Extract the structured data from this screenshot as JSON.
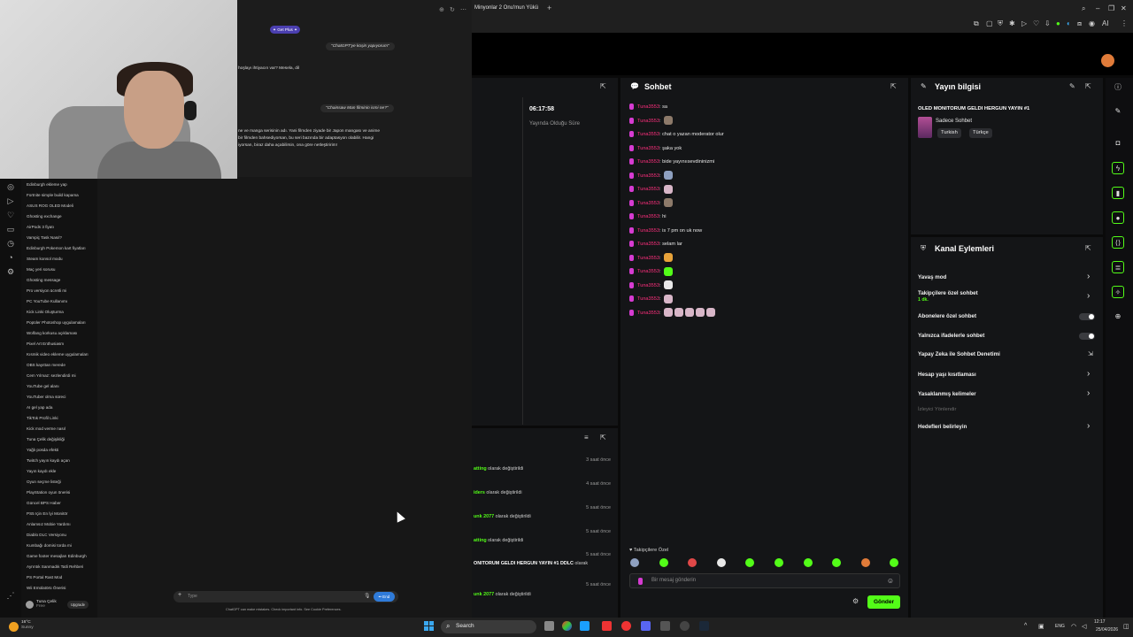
{
  "chatgpt": {
    "get_plus": "✦ Get Plus ✦",
    "bubble1": "\"ChatGPT'ye koşin yapıyorum\"",
    "line1": "hoşlayı ihtiyacın var? Mesela, dil",
    "bubble2": "\"Chainsaw Man filminin ismi ne?\"",
    "answer": [
      "ne ve manga serisinin adı. Yani filmden ziyade bir Japon mangası ve anime",
      "bir filmden bahsediyorsan, bu seri bazında bir adaptasyon olabilir. Hangi",
      "iyorsan, biraz daha açabilirsin, ona göre netleştiririm!"
    ],
    "history": [
      "Edinburgh ekleme yap",
      "Fortnite simple build kapama",
      "ASUS ROG OLED Modeli",
      "Ghosting exchange",
      "AirPods 3 fiyatı",
      "Vampiç Task Nasıl?",
      "Edinburgh Pokemon kart fiyatları",
      "Steam konsol modu",
      "Maç yeri sorusu",
      "Ghosting message",
      "Pro versiyon ücretli mi",
      "PC YouTube Kullanımı",
      "Kick Linki Oluşturma",
      "Popüler Photoshop uygulamaları",
      "Wolfang korkusu açıklaması",
      "Pixel Art Enthusiasm",
      "Kısmik video ekleme uygulamaları",
      "OBS kayıttan merede",
      "Cem Yılmaz: sezlendirdi mi",
      "YouTube gel alanı",
      "YouTuber olma süreci",
      "AI gel yap ada",
      "TikTok Profil Linki",
      "Kick mod verme nasıl",
      "Tuna Çelik değişikliği",
      "Yağlı posda efekti",
      "Twitch yayın kaydı açan",
      "Yayın kaydı ekle",
      "Oyun seçme listeği",
      "PlayStation oyun önerisi",
      "Güncel BPS Haber",
      "PS5 Için En İyi Monitör",
      "Anlamsız Mobie Yardımı",
      "Diablo DLC Versiyonu",
      "Kumbağı domisi torda mi",
      "Game footer mesajları Edinburgh",
      "Ayrıntık Sanmadık Tatli Rehberi",
      "PS Portal Rast Mod",
      "Wii Emülatörü Önerisi"
    ],
    "user_name": "Tuna Çelik",
    "user_plan": "Free",
    "upgrade": "Upgrade",
    "composer_placeholder": "Type",
    "end_label": "•• End",
    "disclaimer": "ChatGPT can make mistakes. Check important info. See Cookie Preferences."
  },
  "browser": {
    "tab_title": "Minyonlar 2 Onu'mun Yükü",
    "new_tab": "+"
  },
  "stats": {
    "time": "06:17:58",
    "label": "Yayında Olduğu Süre"
  },
  "log": {
    "rows": [
      {
        "name": "atting",
        "name_color": "green",
        "text": " olarak değiştirildi",
        "time": "3 saat önce"
      },
      {
        "name": "iders",
        "name_color": "green",
        "text": " olarak değiştirildi",
        "time": "4 saat önce"
      },
      {
        "name": "unk 2077",
        "name_color": "green",
        "text": " olarak değiştirildi",
        "time": "5 saat önce"
      },
      {
        "name": "atting",
        "name_color": "green",
        "text": " olarak değiştirildi",
        "time": "5 saat önce"
      },
      {
        "name": "ONITORUM GELDI HERGUN YAYIN #1 DDLC",
        "name_color": "white",
        "text": " olarak",
        "time": "5 saat önce"
      },
      {
        "name": "unk 2077",
        "name_color": "green",
        "text": " olarak değiştirildi",
        "time": "5 saat önce"
      }
    ]
  },
  "chat": {
    "title": "Sohbet",
    "username": "Tuna3553",
    "messages": [
      {
        "text": "sa",
        "emotes": []
      },
      {
        "text": "",
        "emotes": [
          "#8d7a6a"
        ]
      },
      {
        "text": "chat o yazan moderator olur",
        "emotes": []
      },
      {
        "text": "şaka yok",
        "emotes": []
      },
      {
        "text": "bide yayınıısevdininizmi",
        "emotes": []
      },
      {
        "text": "",
        "emotes": [
          "#8ea0c0"
        ]
      },
      {
        "text": "",
        "emotes": [
          "#d8b6c8"
        ]
      },
      {
        "text": "",
        "emotes": [
          "#8d7a6a"
        ]
      },
      {
        "text": "hi",
        "emotes": []
      },
      {
        "text": "is 7 pm on uk now",
        "emotes": []
      },
      {
        "text": "selam lar",
        "emotes": []
      },
      {
        "text": "",
        "emotes": [
          "#e8a33a"
        ]
      },
      {
        "text": "",
        "emotes": [
          "#53fc18"
        ]
      },
      {
        "text": "",
        "emotes": [
          "#e8e8e8"
        ]
      },
      {
        "text": "",
        "emotes": [
          "#d8b6c8"
        ]
      },
      {
        "text": "",
        "emotes": [
          "#d8b6c8",
          "#d8b6c8",
          "#d8b6c8",
          "#d8b6c8",
          "#d8b6c8"
        ]
      }
    ],
    "followers_only": "♥ Takipçilere Özel",
    "emote_bar": [
      "#8ea0c0",
      "#53fc18",
      "#e04848",
      "#e8e8e8",
      "#53fc18",
      "#53fc18",
      "#53fc18",
      "#53fc18",
      "#e07b39",
      "#53fc18"
    ],
    "input_placeholder": "Bir mesaj gönderin",
    "send_label": "Gönder"
  },
  "stream_info": {
    "title": "Yayın bilgisi",
    "stream_title": "OLED MONITORUM GELDI HERGUN YAYIN #1",
    "category": "Sadece Sohbet",
    "tags": [
      "Turkish",
      "Türkçe"
    ]
  },
  "channel_actions": {
    "title": "Kanal Eylemleri",
    "slow_mode": "Yavaş mod",
    "followers_only": "Takipçilere özel sohbet",
    "followers_only_sub": "1 dk.",
    "subscribers_only": "Abonelere özel sohbet",
    "emotes_only": "Yalnızca ifadelerle sohbet",
    "ai_moderation": "Yapay Zeka ile Sohbet Denetimi",
    "account_age": "Hesap yaşı kısıtlaması",
    "banned_words": "Yasaklanmış kelimeler",
    "hosting": "İzleyici Yönlendir",
    "set_goals": "Hedefleri belirleyin"
  },
  "taskbar": {
    "weather_temp": "16°C",
    "weather_desc": "Sunny",
    "search": "Search",
    "lang": "ENG",
    "time": "12:17",
    "date": "25/04/2026"
  }
}
